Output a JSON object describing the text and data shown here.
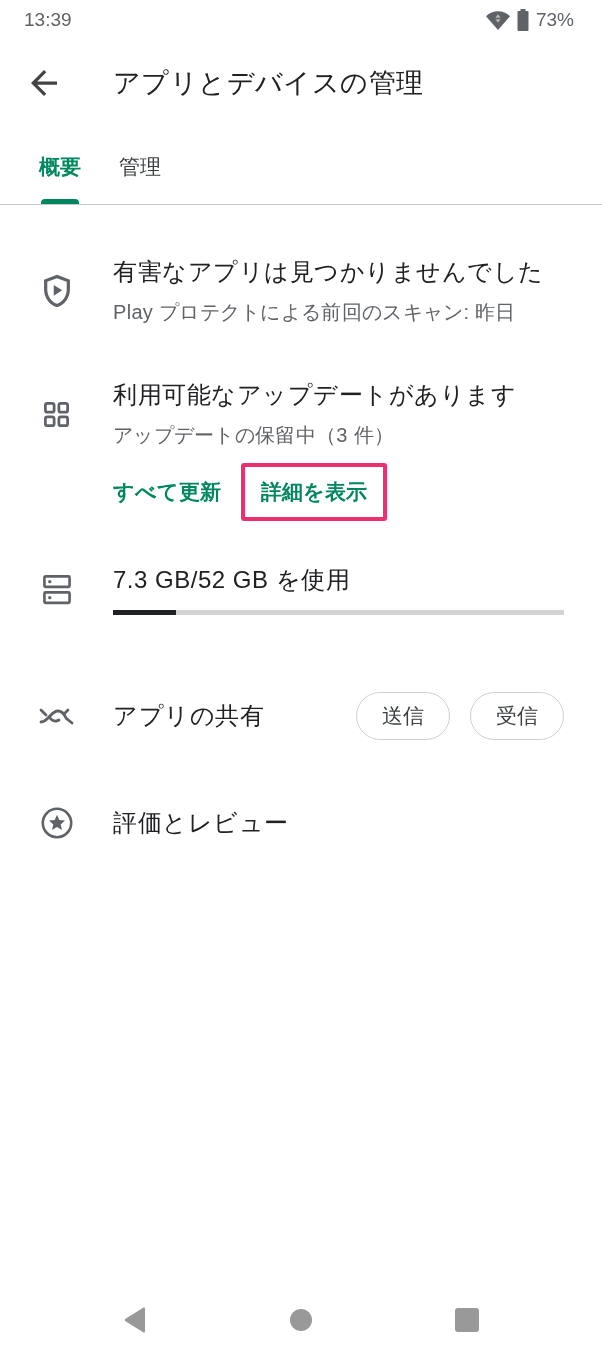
{
  "status_bar": {
    "time": "13:39",
    "battery": "73%"
  },
  "app_bar": {
    "title": "アプリとデバイスの管理"
  },
  "tabs": [
    {
      "label": "概要",
      "selected": true
    },
    {
      "label": "管理",
      "selected": false
    }
  ],
  "sections": [
    {
      "kind": "protection",
      "title": "有害なアプリは見つかりませんでした",
      "subtitle": "Play プロテクトによる前回のスキャン: 昨日"
    },
    {
      "kind": "updates",
      "title": "利用可能なアップデートがあります",
      "subtitle": "アップデートの保留中（3 件）",
      "actions": [
        {
          "label": "すべて更新",
          "highlighted": false
        },
        {
          "label": "詳細を表示",
          "highlighted": true
        }
      ]
    },
    {
      "kind": "storage",
      "title": "7.3 GB/52 GB を使用",
      "level": 0.14
    },
    {
      "kind": "sharing",
      "title": "アプリの共有",
      "buttons": [
        "送信",
        "受信"
      ]
    },
    {
      "kind": "reviews",
      "title": "評価とレビュー"
    }
  ]
}
